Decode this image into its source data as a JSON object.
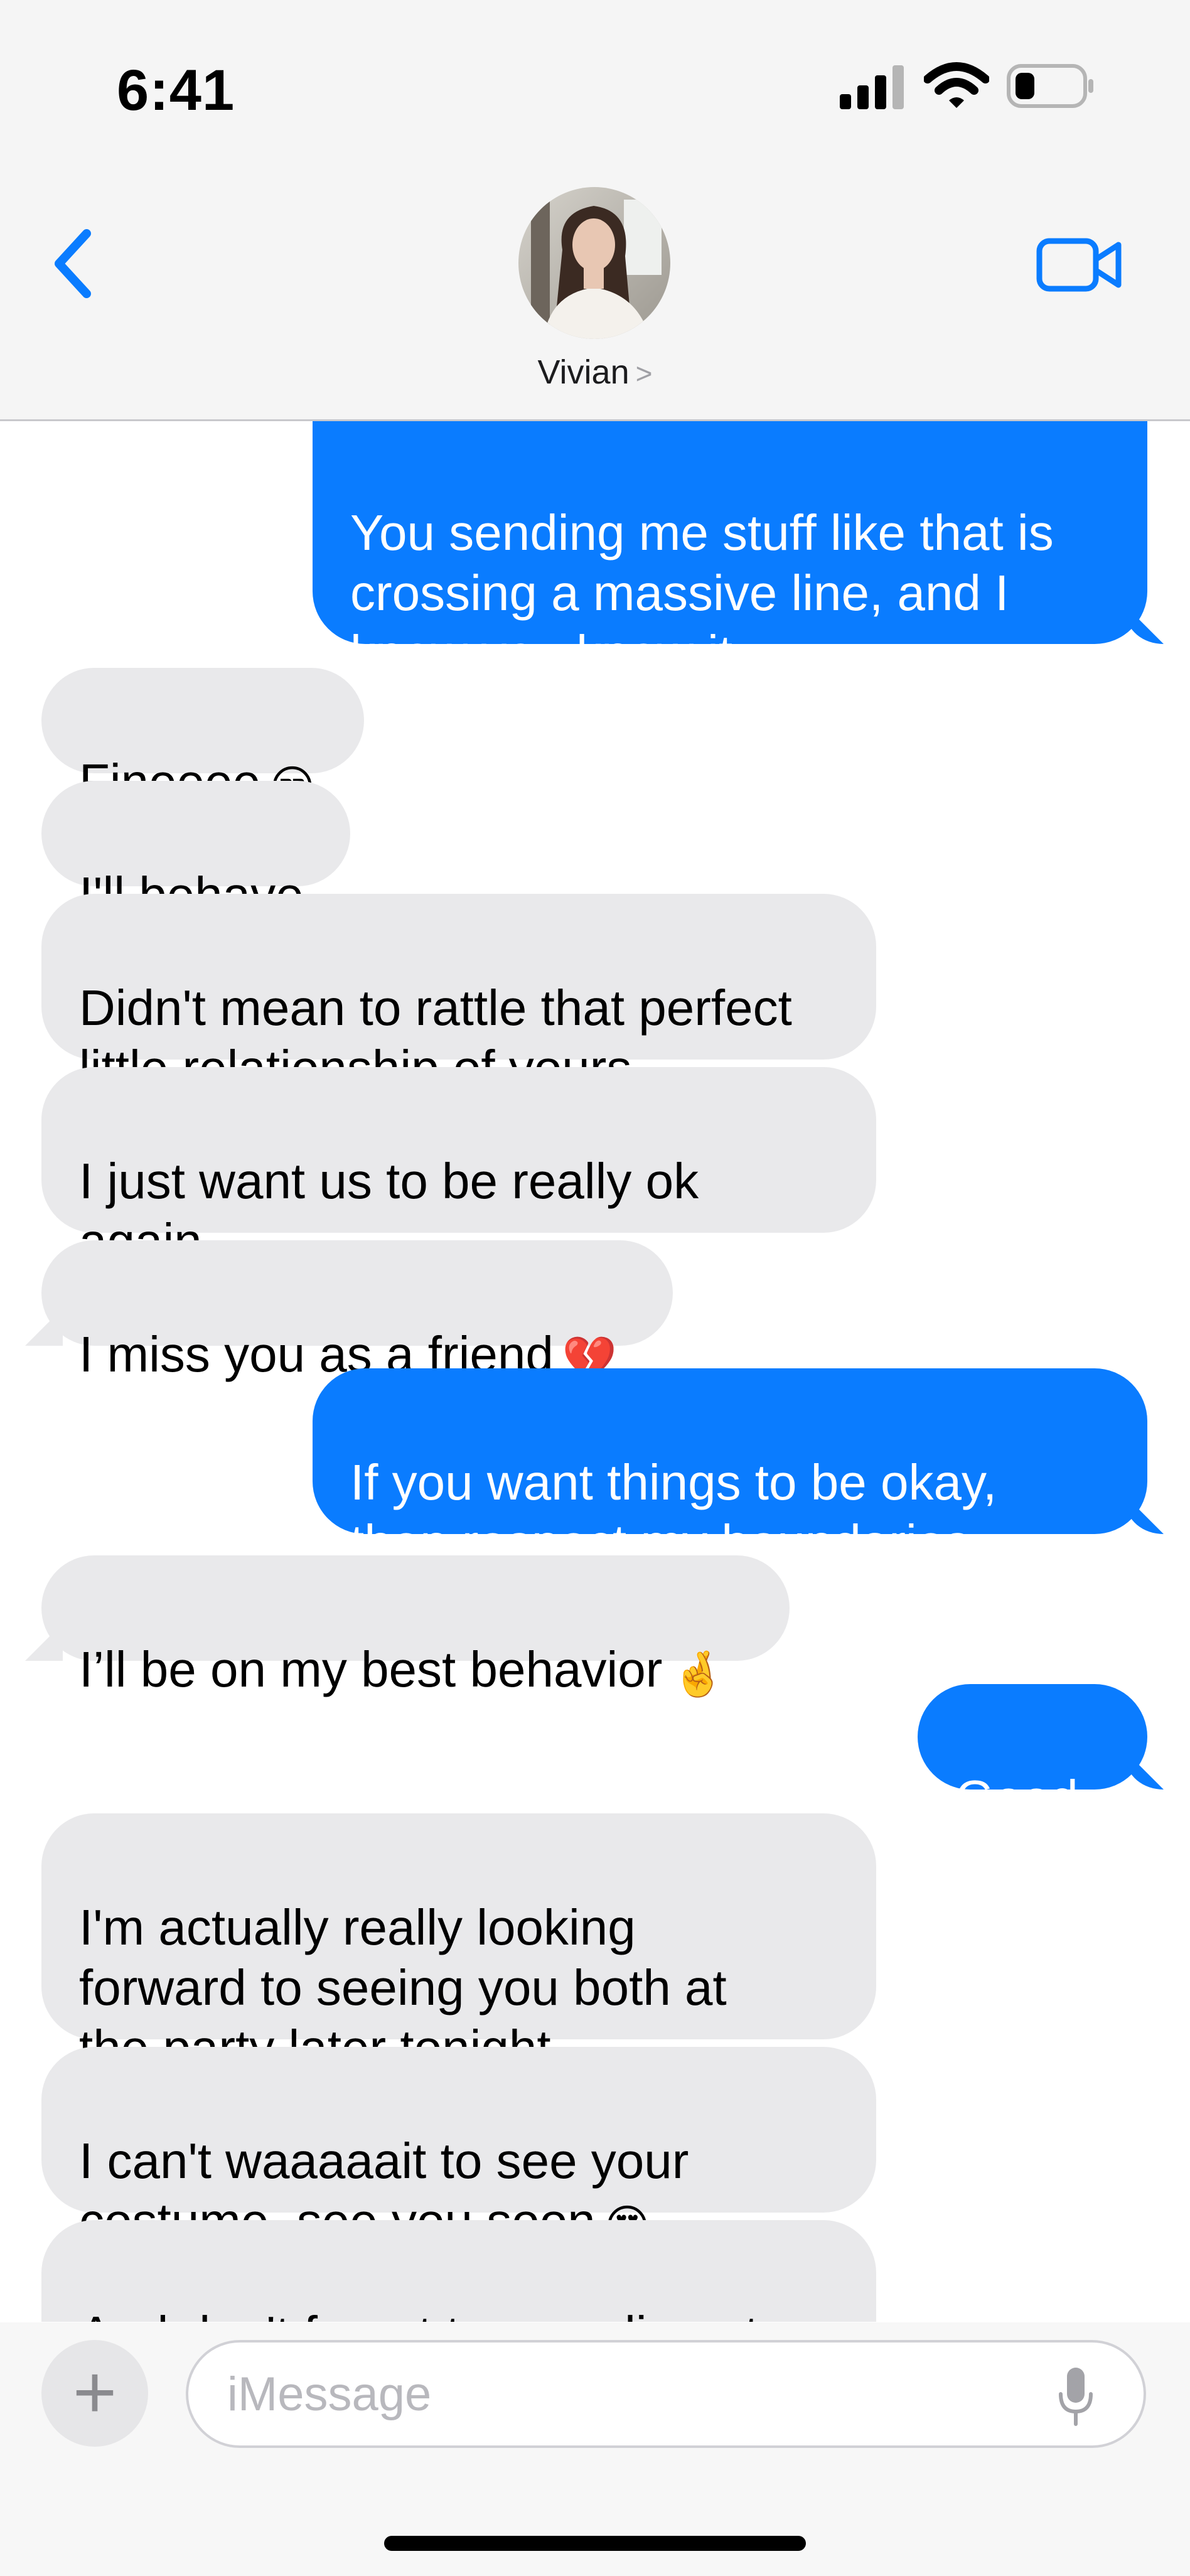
{
  "status_bar": {
    "time": "6:41"
  },
  "header": {
    "contact_name": "Vivian",
    "contact_chevron": ">",
    "back_icon": "chevron-left-icon",
    "video_icon": "video-camera-icon",
    "accent_color": "#0a7cff"
  },
  "messages": [
    {
      "from": "me",
      "text": "You sending me stuff like that is\ncrossing a massive line, and I\nknow you know it",
      "emoji": ""
    },
    {
      "from": "them",
      "text": "Fineeee",
      "emoji": "😒"
    },
    {
      "from": "them",
      "text": "I'll behave",
      "emoji": ""
    },
    {
      "from": "them",
      "text": "Didn't mean to rattle that perfect\nlittle relationship of yours",
      "emoji": ""
    },
    {
      "from": "them",
      "text": "I just want us to be really ok\nagain",
      "emoji": ""
    },
    {
      "from": "them",
      "text": "I miss you as a friend",
      "emoji": "💔"
    },
    {
      "from": "me",
      "text": "If you want things to be okay,\nthen respect my boundaries",
      "emoji": ""
    },
    {
      "from": "them",
      "text": "I’ll be on my best behavior",
      "emoji": "🤞"
    },
    {
      "from": "me",
      "text": "Good..",
      "emoji": ""
    },
    {
      "from": "them",
      "text": "I'm actually really looking\nforward to seeing you both at\nthe party later tonight",
      "emoji": ""
    },
    {
      "from": "them",
      "text": "I can't waaaaait to see your\ncostume, see you soon",
      "emoji": "😍"
    },
    {
      "from": "them",
      "text": "And don't forget to compliment\nmy costume okay?",
      "emoji": "😉"
    }
  ],
  "input": {
    "placeholder": "iMessage",
    "plus_label": "+",
    "mic_icon": "microphone-icon"
  }
}
